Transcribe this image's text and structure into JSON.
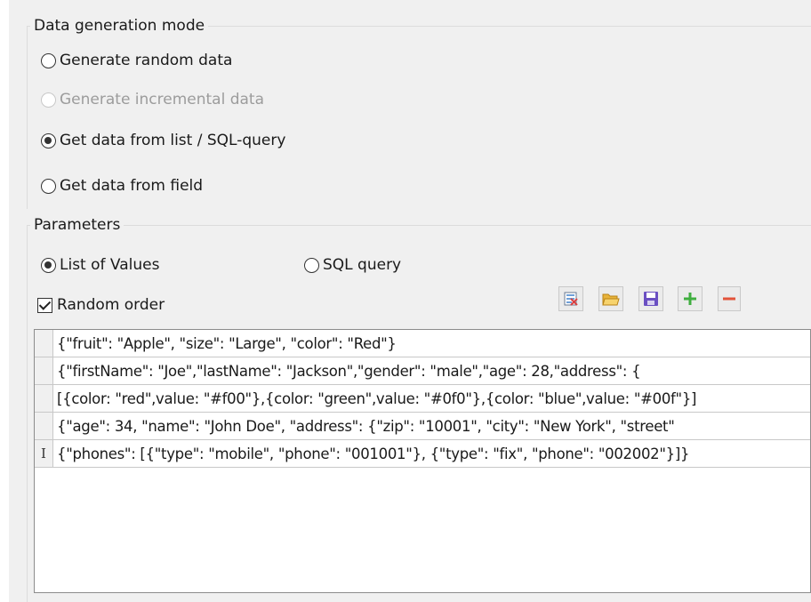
{
  "mode_group": {
    "title": "Data generation mode",
    "options": [
      {
        "label": "Generate random data",
        "checked": false,
        "enabled": true
      },
      {
        "label": "Generate incremental data",
        "checked": false,
        "enabled": false
      },
      {
        "label": "Get data from list / SQL-query",
        "checked": true,
        "enabled": true
      },
      {
        "label": "Get data from field",
        "checked": false,
        "enabled": true
      }
    ]
  },
  "params_group": {
    "title": "Parameters",
    "source_options": [
      {
        "label": "List of Values",
        "checked": true
      },
      {
        "label": "SQL query",
        "checked": false
      }
    ],
    "random_order": {
      "label": "Random order",
      "checked": true
    },
    "toolbar": {
      "buttons": [
        {
          "icon": "clear-list-icon"
        },
        {
          "icon": "open-folder-icon"
        },
        {
          "icon": "save-disk-icon"
        },
        {
          "icon": "add-plus-icon"
        },
        {
          "icon": "remove-minus-icon"
        }
      ]
    }
  },
  "values_list": {
    "rows": [
      "{\"fruit\": \"Apple\", \"size\": \"Large\", \"color\": \"Red\"}",
      "{\"firstName\": \"Joe\",\"lastName\": \"Jackson\",\"gender\": \"male\",\"age\": 28,\"address\": {",
      "[{color: \"red\",value: \"#f00\"},{color: \"green\",value: \"#0f0\"},{color: \"blue\",value: \"#00f\"}]",
      "{\"age\": 34, \"name\": \"John Doe\", \"address\": {\"zip\": \"10001\", \"city\": \"New York\", \"street\"",
      "{\"phones\": [{\"type\": \"mobile\", \"phone\": \"001001\"}, {\"type\": \"fix\", \"phone\": \"002002\"}]}"
    ],
    "current_row_marker": "I"
  }
}
